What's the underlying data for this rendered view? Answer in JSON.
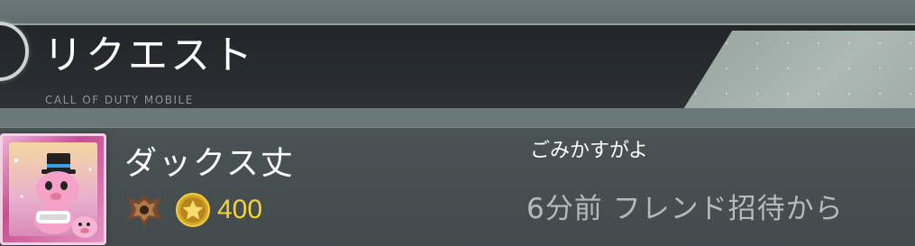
{
  "header": {
    "title": "リクエスト",
    "subtitle": "CALL OF DUTY MOBILE"
  },
  "request": {
    "player_name": "ダックス丈",
    "points": "400",
    "inviter": "ごみかすがよ",
    "meta": "6分前 フレンド招待から",
    "rank_icon": "rank-emblem-icon",
    "currency_icon": "star-coin-icon",
    "avatar_icon": "avatar-pink-character"
  },
  "colors": {
    "points": "#f4d23c",
    "title": "#ffffff",
    "meta": "#b5bbbb",
    "header_bg": "#232628",
    "row_bg": "#4a5253"
  }
}
